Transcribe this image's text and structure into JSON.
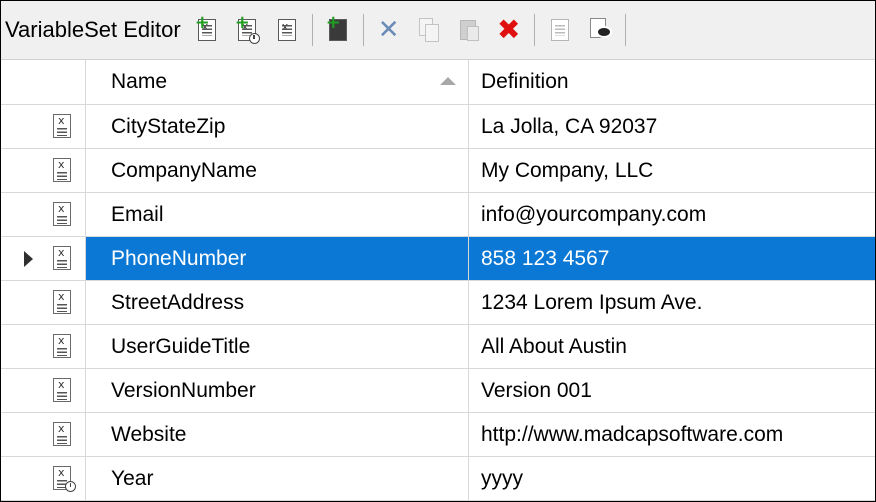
{
  "toolbar": {
    "title": "VariableSet Editor",
    "buttons": [
      {
        "icon": "add-variable-icon"
      },
      {
        "icon": "add-datetime-variable-icon"
      },
      {
        "icon": "edit-variable-icon"
      },
      {
        "icon": "add-from-file-icon"
      },
      {
        "icon": "cut-icon"
      },
      {
        "icon": "copy-icon"
      },
      {
        "icon": "paste-icon"
      },
      {
        "icon": "delete-icon"
      },
      {
        "icon": "properties-icon"
      },
      {
        "icon": "preview-icon"
      }
    ]
  },
  "grid": {
    "columns": {
      "name": "Name",
      "definition": "Definition"
    },
    "sort": {
      "column": "Name",
      "direction": "ascending"
    },
    "rows": [
      {
        "name": "CityStateZip",
        "definition": "La Jolla, CA 92037",
        "type": "text"
      },
      {
        "name": "CompanyName",
        "definition": "My Company, LLC",
        "type": "text"
      },
      {
        "name": "Email",
        "definition": "info@yourcompany.com",
        "type": "text"
      },
      {
        "name": "PhoneNumber",
        "definition": "858 123 4567",
        "type": "text",
        "selected": true
      },
      {
        "name": "StreetAddress",
        "definition": "1234 Lorem Ipsum Ave.",
        "type": "text"
      },
      {
        "name": "UserGuideTitle",
        "definition": "All About Austin",
        "type": "text"
      },
      {
        "name": "VersionNumber",
        "definition": "Version 001",
        "type": "text"
      },
      {
        "name": "Website",
        "definition": "http://www.madcapsoftware.com",
        "type": "text"
      },
      {
        "name": "Year",
        "definition": "yyyy",
        "type": "datetime"
      }
    ]
  },
  "colors": {
    "selection": "#0a78d4",
    "add_plus": "#1f9e1f",
    "delete": "#e01010"
  }
}
